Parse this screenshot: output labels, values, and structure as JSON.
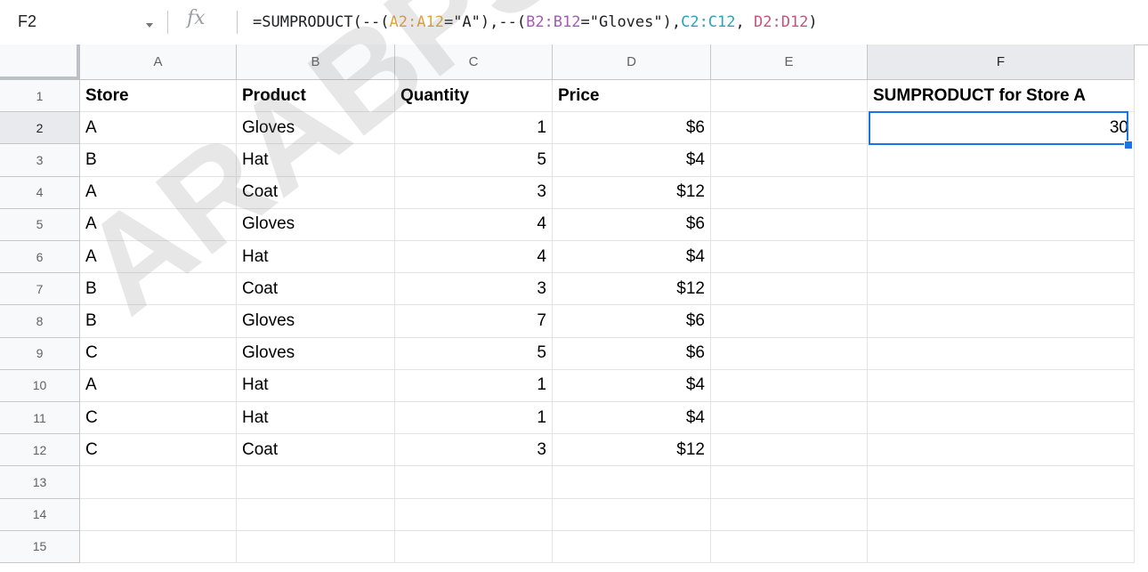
{
  "formula_bar": {
    "cell_ref": "F2",
    "fx_label": "fx",
    "formula_segments": [
      {
        "text": "=SUMPRODUCT(--(",
        "color": "#202124"
      },
      {
        "text": "A2:A12",
        "color": "#e6a23c"
      },
      {
        "text": "=\"A\"),--(",
        "color": "#202124"
      },
      {
        "text": "B2:B12",
        "color": "#a35bb5"
      },
      {
        "text": "=\"Gloves\"),",
        "color": "#202124"
      },
      {
        "text": "C2:C12",
        "color": "#2aa3b8"
      },
      {
        "text": ", ",
        "color": "#202124"
      },
      {
        "text": "D2:D12",
        "color": "#c2557a"
      },
      {
        "text": ")",
        "color": "#202124"
      }
    ]
  },
  "columns": [
    "A",
    "B",
    "C",
    "D",
    "E",
    "F"
  ],
  "selected_column": "F",
  "rows": [
    {
      "num": "1",
      "cells": [
        "Store",
        "Product",
        "Quantity",
        "Price",
        "",
        "SUMPRODUCT for Store A"
      ],
      "bold": true
    },
    {
      "num": "2",
      "cells": [
        "A",
        "Gloves",
        "1",
        "$6",
        "",
        "30"
      ]
    },
    {
      "num": "3",
      "cells": [
        "B",
        "Hat",
        "5",
        "$4",
        "",
        ""
      ]
    },
    {
      "num": "4",
      "cells": [
        "A",
        "Coat",
        "3",
        "$12",
        "",
        ""
      ]
    },
    {
      "num": "5",
      "cells": [
        "A",
        "Gloves",
        "4",
        "$6",
        "",
        ""
      ]
    },
    {
      "num": "6",
      "cells": [
        "A",
        "Hat",
        "4",
        "$4",
        "",
        ""
      ]
    },
    {
      "num": "7",
      "cells": [
        "B",
        "Coat",
        "3",
        "$12",
        "",
        ""
      ]
    },
    {
      "num": "8",
      "cells": [
        "B",
        "Gloves",
        "7",
        "$6",
        "",
        ""
      ]
    },
    {
      "num": "9",
      "cells": [
        "C",
        "Gloves",
        "5",
        "$6",
        "",
        ""
      ]
    },
    {
      "num": "10",
      "cells": [
        "A",
        "Hat",
        "1",
        "$4",
        "",
        ""
      ]
    },
    {
      "num": "11",
      "cells": [
        "C",
        "Hat",
        "1",
        "$4",
        "",
        ""
      ]
    },
    {
      "num": "12",
      "cells": [
        "C",
        "Coat",
        "3",
        "$12",
        "",
        ""
      ]
    },
    {
      "num": "13",
      "cells": [
        "",
        "",
        "",
        "",
        "",
        ""
      ]
    },
    {
      "num": "14",
      "cells": [
        "",
        "",
        "",
        "",
        "",
        ""
      ]
    },
    {
      "num": "15",
      "cells": [
        "",
        "",
        "",
        "",
        "",
        ""
      ]
    }
  ],
  "selected_row": "2",
  "active_cell": "F2",
  "watermark": "ARABPSYCH",
  "colors": {
    "selection": "#1a73e8",
    "header_bg": "#f8f9fa",
    "gridline": "#e2e3e3"
  }
}
